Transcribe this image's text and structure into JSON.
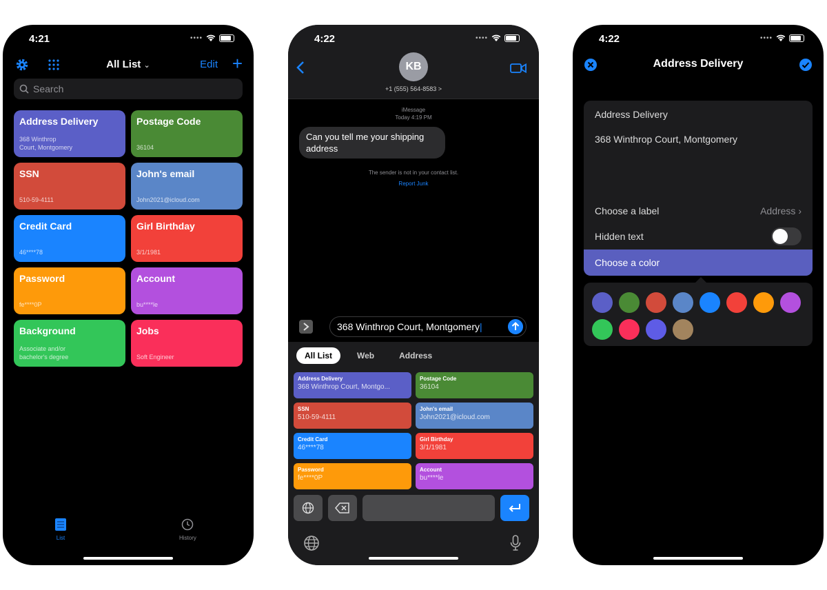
{
  "phones": [
    {
      "time": "4:21",
      "nav": {
        "title": "All List",
        "edit": "Edit",
        "plus": "+"
      },
      "search_placeholder": "Search",
      "cards": [
        {
          "title": "Address Delivery",
          "subtitle": "368 Winthrop\nCourt, Montgomery",
          "color": "#5b5fc7"
        },
        {
          "title": "Postage Code",
          "subtitle": "36104",
          "color": "#4a8a35"
        },
        {
          "title": "SSN",
          "subtitle": "510-59-4111",
          "color": "#d24b3b"
        },
        {
          "title": "John's email",
          "subtitle": "John2021@icloud.com",
          "color": "#5a86c8"
        },
        {
          "title": "Credit Card",
          "subtitle": "46****78",
          "color": "#1a84ff"
        },
        {
          "title": "Girl Birthday",
          "subtitle": "3/1/1981",
          "color": "#f2413a"
        },
        {
          "title": "Password",
          "subtitle": "fe****0P",
          "color": "#fe9a0a"
        },
        {
          "title": "Account",
          "subtitle": "bu****le",
          "color": "#b350de"
        },
        {
          "title": "Background",
          "subtitle": "Associate and/or\nbachelor's degree",
          "color": "#33c659"
        },
        {
          "title": "Jobs",
          "subtitle": "Soft Engineer",
          "color": "#fa2f5a"
        }
      ],
      "tabs": {
        "list": "List",
        "history": "History"
      }
    },
    {
      "time": "4:22",
      "contact": {
        "initials": "KB",
        "phone": "+1 (555) 564-8583 >"
      },
      "imessage": "iMessage",
      "timestamp": "Today 4:19 PM",
      "bubble": "Can you tell me your shipping address",
      "notice": "The sender is not in your contact list.",
      "report_junk": "Report Junk",
      "input_value": "368 Winthrop Court, Montgomery",
      "segments": [
        "All List",
        "Web",
        "Address"
      ],
      "kcards": [
        {
          "title": "Address Delivery",
          "subtitle": "368 Winthrop Court, Montgo...",
          "color": "#5b5fc7"
        },
        {
          "title": "Postage Code",
          "subtitle": "36104",
          "color": "#4a8a35"
        },
        {
          "title": "SSN",
          "subtitle": "510-59-4111",
          "color": "#d24b3b"
        },
        {
          "title": "John's email",
          "subtitle": "John2021@icloud.com",
          "color": "#5a86c8"
        },
        {
          "title": "Credit Card",
          "subtitle": "46****78",
          "color": "#1a84ff"
        },
        {
          "title": "Girl Birthday",
          "subtitle": "3/1/1981",
          "color": "#f2413a"
        },
        {
          "title": "Password",
          "subtitle": "fe****0P",
          "color": "#fe9a0a"
        },
        {
          "title": "Account",
          "subtitle": "bu****le",
          "color": "#b350de"
        }
      ]
    },
    {
      "time": "4:22",
      "nav": {
        "title": "Address Delivery"
      },
      "form": {
        "label": "Address Delivery",
        "address": "368 Winthrop Court, Montgomery",
        "choose_label": "Choose a label",
        "label_value": "Address",
        "hidden_text": "Hidden text",
        "hidden_on": false,
        "choose_color": "Choose a color"
      },
      "palette": [
        "#5b5fc7",
        "#4a8a35",
        "#d24b3b",
        "#5a86c8",
        "#1a84ff",
        "#f2413a",
        "#fe9a0a",
        "#b350de",
        "#33c659",
        "#fa2f5a",
        "#5e5ce6",
        "#a2845e"
      ]
    }
  ]
}
